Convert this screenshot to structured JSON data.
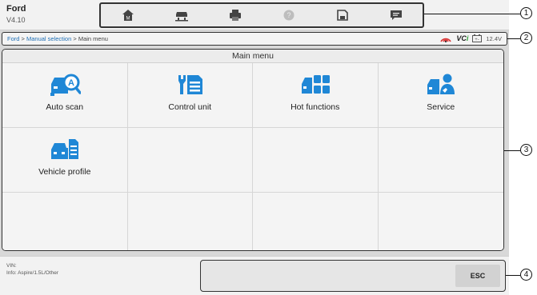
{
  "app": {
    "name": "Ford",
    "version": "V4.10"
  },
  "toolbar": {
    "buttons": [
      "home-icon",
      "vehicle-lift-icon",
      "printer-icon",
      "help-icon",
      "save-icon",
      "message-icon"
    ]
  },
  "breadcrumb": {
    "root": "Ford",
    "sep1": " > ",
    "mid": "Manual selection",
    "sep2": " > ",
    "current": "Main menu"
  },
  "status": {
    "vci_prefix": "VC",
    "vci_suffix": "i",
    "voltage": "12.4V"
  },
  "main": {
    "title": "Main menu",
    "tiles": [
      {
        "label": "Auto scan",
        "icon": "auto-scan-icon"
      },
      {
        "label": "Control unit",
        "icon": "control-unit-icon"
      },
      {
        "label": "Hot functions",
        "icon": "hot-functions-icon"
      },
      {
        "label": "Service",
        "icon": "service-icon"
      },
      {
        "label": "Vehicle profile",
        "icon": "vehicle-profile-icon"
      }
    ]
  },
  "footer": {
    "vin": "VIN:",
    "info": "Info: Aspire/1.5L/Other",
    "esc_label": "ESC"
  },
  "callouts": [
    "1",
    "2",
    "3",
    "4"
  ],
  "colors": {
    "icon_blue": "#1f87d6",
    "link_blue": "#1f6fb5",
    "vci_green": "#2aa034",
    "signal_red": "#d93636"
  }
}
